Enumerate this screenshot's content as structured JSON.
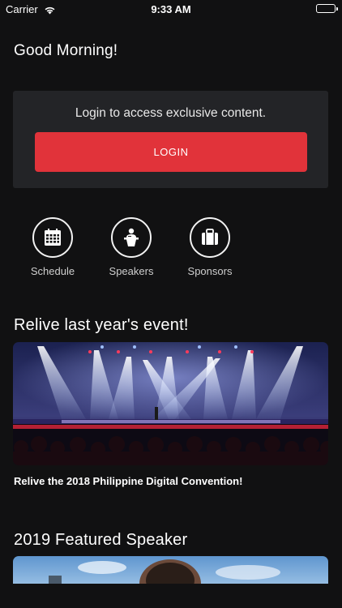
{
  "status_bar": {
    "carrier": "Carrier",
    "time": "9:33 AM"
  },
  "greeting": "Good Morning!",
  "login_card": {
    "message": "Login to access exclusive content.",
    "button_label": "LOGIN"
  },
  "quick_links": [
    {
      "label": "Schedule",
      "icon": "calendar-icon"
    },
    {
      "label": "Speakers",
      "icon": "podium-speaker-icon"
    },
    {
      "label": "Sponsors",
      "icon": "briefcase-icon"
    }
  ],
  "relive": {
    "title": "Relive last year's event!",
    "caption": "Relive the 2018 Philippine Digital Convention!"
  },
  "featured": {
    "title": "2019 Featured Speaker"
  },
  "colors": {
    "background": "#111112",
    "card": "#232427",
    "accent": "#e1333a"
  }
}
